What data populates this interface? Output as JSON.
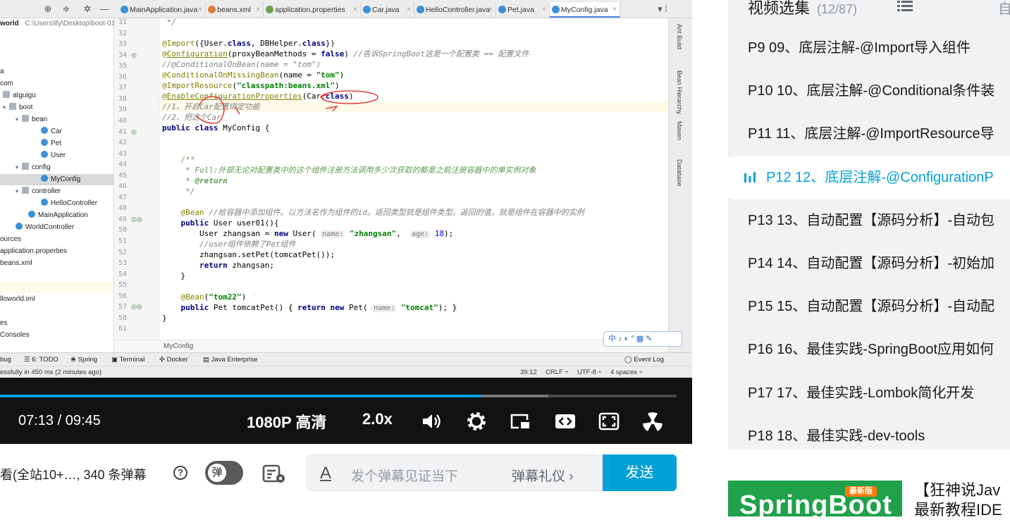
{
  "ide": {
    "tabs": [
      {
        "label": "MainApplication.java",
        "icon_color": "#3d8fd6"
      },
      {
        "label": "beans.xml",
        "icon_color": "#e07b39"
      },
      {
        "label": "application.properties",
        "icon_color": "#6a9f4b"
      },
      {
        "label": "Car.java",
        "icon_color": "#3d8fd6"
      },
      {
        "label": "HelloController.java",
        "icon_color": "#3d8fd6"
      },
      {
        "label": "Pet.java",
        "icon_color": "#3d8fd6"
      },
      {
        "label": "MyConfig.java",
        "icon_color": "#3d8fd6"
      }
    ],
    "tabs_more": "▾ ⁞",
    "project_root_label": "world",
    "project_root_path": "C:\\Users\\lfy\\Desktop\\boot-01-",
    "tree": [
      {
        "label": "a",
        "kind": "none",
        "indent": 0,
        "arrow": ""
      },
      {
        "label": "com",
        "kind": "none",
        "indent": 0,
        "arrow": ""
      },
      {
        "label": "atguigu",
        "kind": "pkg",
        "indent": 4,
        "arrow": ""
      },
      {
        "label": "boot",
        "kind": "pkg",
        "indent": 4,
        "arrow": "v"
      },
      {
        "label": "bean",
        "kind": "pkg",
        "indent": 22,
        "arrow": "v"
      },
      {
        "label": "Car",
        "kind": "cls",
        "indent": 58,
        "arrow": ""
      },
      {
        "label": "Pet",
        "kind": "cls",
        "indent": 58,
        "arrow": ""
      },
      {
        "label": "User",
        "kind": "cls",
        "indent": 58,
        "arrow": ""
      },
      {
        "label": "config",
        "kind": "pkg",
        "indent": 22,
        "arrow": "v"
      },
      {
        "label": "MyConfig",
        "kind": "cls",
        "indent": 58,
        "arrow": "",
        "selected": true
      },
      {
        "label": "controller",
        "kind": "pkg",
        "indent": 22,
        "arrow": "v"
      },
      {
        "label": "HelloController",
        "kind": "cls",
        "indent": 58,
        "arrow": ""
      },
      {
        "label": "MainApplication",
        "kind": "cls",
        "indent": 40,
        "arrow": ""
      },
      {
        "label": "WorldController",
        "kind": "cls",
        "indent": 22,
        "arrow": ""
      },
      {
        "label": "ources",
        "kind": "none",
        "indent": 0,
        "arrow": ""
      },
      {
        "label": "application.properties",
        "kind": "none",
        "indent": 0,
        "arrow": ""
      },
      {
        "label": "beans.xml",
        "kind": "none",
        "indent": 0,
        "arrow": ""
      },
      {
        "label": "",
        "kind": "none",
        "indent": 0,
        "arrow": ""
      },
      {
        "label": "",
        "kind": "none",
        "indent": 0,
        "arrow": "",
        "highlight": true
      },
      {
        "label": "lloworld.iml",
        "kind": "none",
        "indent": 0,
        "arrow": ""
      },
      {
        "label": "",
        "kind": "none",
        "indent": 0,
        "arrow": ""
      },
      {
        "label": "es",
        "kind": "none",
        "indent": 0,
        "arrow": ""
      },
      {
        "label": "Consoles",
        "kind": "none",
        "indent": 0,
        "arrow": ""
      }
    ],
    "line_numbers": [
      "31",
      "32",
      "33",
      "34",
      "35",
      "36",
      "37",
      "38",
      "39",
      "40",
      "41",
      "42",
      "43",
      "44",
      "45",
      "46",
      "47",
      "48",
      "49",
      "50",
      "51",
      "52",
      "53",
      "54",
      "55",
      "56",
      "57",
      "58",
      "61"
    ],
    "gutter_marks": {
      "34": "◎",
      "41": "◎",
      "49": "◎◎",
      "57": "◎◎"
    },
    "breadcrumb": "MyConfig",
    "right_tools": [
      "Ant Build",
      "Bean Hierarchy",
      "Maven",
      "Database"
    ],
    "ime_text": "中 ♪ ◐ ° ▦ ✎",
    "bottom_tools": [
      "bug",
      "6: TODO",
      "Spring",
      "Terminal",
      "Docker",
      "Java Enterprise",
      "Event Log"
    ],
    "status_left": "essfully in 450 ms (2 minutes ago)",
    "status_right": [
      "39:12",
      "CRLF ÷",
      "UTF-8 ÷",
      "4 spaces ÷"
    ]
  },
  "video": {
    "current_time": "07:13",
    "separator": "/",
    "total_time": "09:45",
    "progress": 0.71,
    "buffered": 0.81,
    "quality": "1080P 高清",
    "speed": "2.0x"
  },
  "danmaku": {
    "viewers_text": "看(全站10+…, 340 条弹幕",
    "toggle_label": "弹",
    "input_placeholder": "发个弹幕见证当下",
    "etiquette_label": "弹幕礼仪 ›",
    "send_label": "发送",
    "font_icon": "A"
  },
  "sidebar": {
    "title": "视频选集",
    "count": "(12/87)",
    "extra": "自",
    "episodes": [
      {
        "label": "P9   09、底层注解-@Import导入组件"
      },
      {
        "label": "P10   10、底层注解-@Conditional条件装"
      },
      {
        "label": "P11   11、底层注解-@ImportResource导"
      },
      {
        "label": "P12   12、底层注解-@ConfigurationP",
        "active": true
      },
      {
        "label": "P13   13、自动配置【源码分析】-自动包"
      },
      {
        "label": "P14   14、自动配置【源码分析】-初始加"
      },
      {
        "label": "P15   15、自动配置【源码分析】-自动配"
      },
      {
        "label": "P16   16、最佳实践-SpringBoot应用如何"
      },
      {
        "label": "P17   17、最佳实践-Lombok简化开发"
      },
      {
        "label": "P18   18、最佳实践-dev-tools"
      }
    ]
  },
  "recommendation": {
    "thumb_text": "SpringBoot",
    "badge": "最新版",
    "title_line1": "【狂神说Jav",
    "title_line2": "最新教程IDE"
  },
  "colors": {
    "accent": "#00a1d6",
    "green_thumb": "#1fa24a"
  }
}
